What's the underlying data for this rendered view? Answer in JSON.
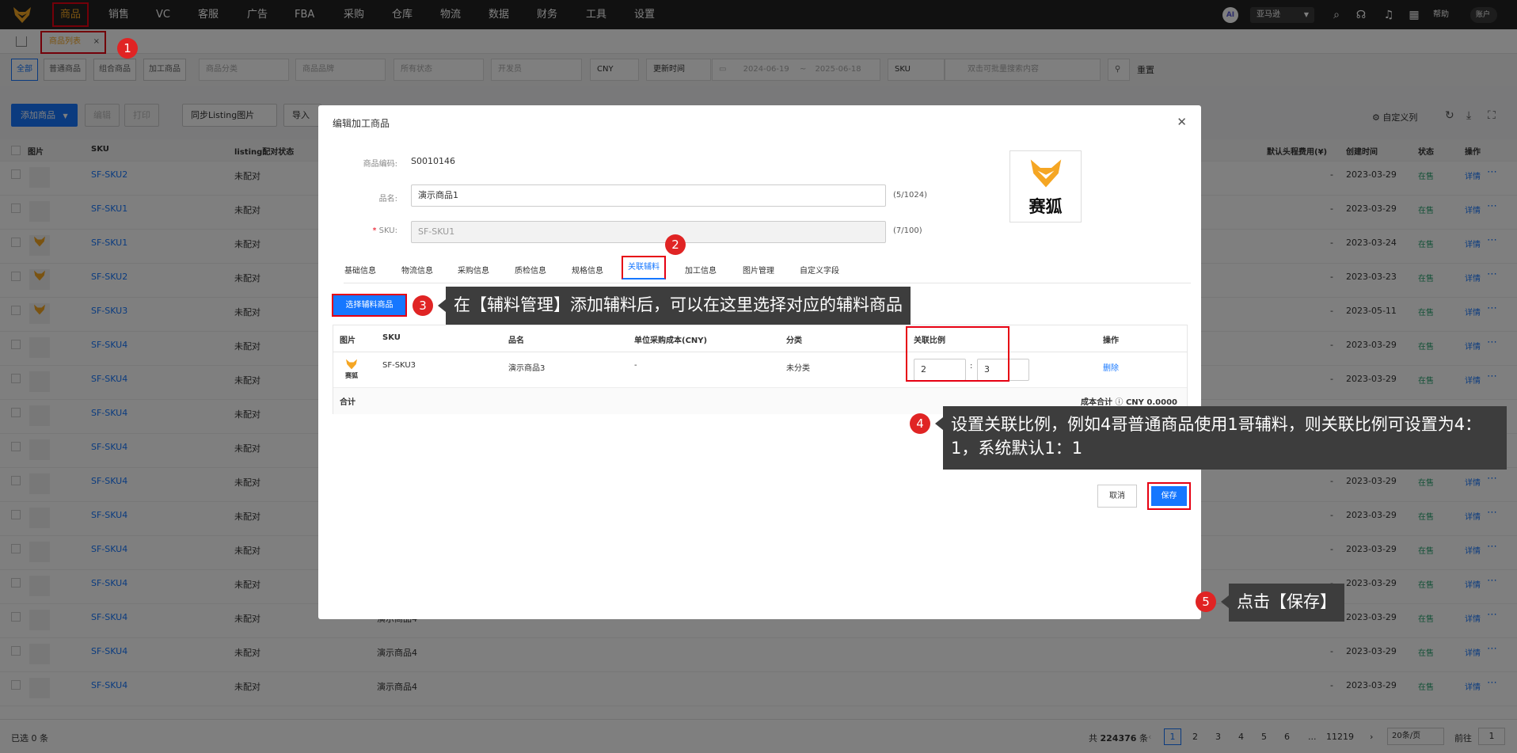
{
  "nav": {
    "items": [
      "商品",
      "销售",
      "VC",
      "客服",
      "广告",
      "FBA",
      "采购",
      "仓库",
      "物流",
      "数据",
      "财务",
      "工具",
      "设置"
    ],
    "ai_label": "AI",
    "store": "亚马逊",
    "help": "帮助",
    "account": "账户"
  },
  "tabs": {
    "current": "商品列表",
    "close": "×"
  },
  "filters": {
    "segments": [
      "全部",
      "普通商品",
      "组合商品",
      "加工商品"
    ],
    "category_ph": "商品分类",
    "brand_ph": "商品品牌",
    "status_ph": "所有状态",
    "developer_ph": "开发员",
    "currency": "CNY",
    "time_type": "更新时间",
    "date_start": "2024-06-19",
    "date_sep": "~",
    "date_end": "2025-06-18",
    "search_field": "SKU",
    "search_ph": "双击可批量搜索内容",
    "reset": "重置"
  },
  "toolbar": {
    "add": "添加商品",
    "edit": "编辑",
    "print": "打印",
    "sync": "同步Listing图片",
    "import": "导入",
    "custom_cols": "自定义列"
  },
  "table": {
    "headers": {
      "image": "图片",
      "sku": "SKU",
      "listing": "listing配对状态",
      "freight": "默认头程费用(¥)",
      "created": "创建时间",
      "status": "状态",
      "ops": "操作"
    },
    "rows": [
      {
        "sku": "SF-SKU2",
        "listing": "未配对",
        "name": "",
        "freight": "-",
        "created": "2023-03-29",
        "status": "在售",
        "detail": "详情",
        "logo": false
      },
      {
        "sku": "SF-SKU1",
        "listing": "未配对",
        "name": "",
        "freight": "-",
        "created": "2023-03-29",
        "status": "在售",
        "detail": "详情",
        "logo": false
      },
      {
        "sku": "SF-SKU1",
        "listing": "未配对",
        "name": "",
        "freight": "-",
        "created": "2023-03-24",
        "status": "在售",
        "detail": "详情",
        "logo": true
      },
      {
        "sku": "SF-SKU2",
        "listing": "未配对",
        "name": "",
        "freight": "-",
        "created": "2023-03-23",
        "status": "在售",
        "detail": "详情",
        "logo": true
      },
      {
        "sku": "SF-SKU3",
        "listing": "未配对",
        "name": "",
        "freight": "-",
        "created": "2023-05-11",
        "status": "在售",
        "detail": "详情",
        "logo": true
      },
      {
        "sku": "SF-SKU4",
        "listing": "未配对",
        "name": "",
        "freight": "-",
        "created": "2023-03-29",
        "status": "在售",
        "detail": "详情",
        "logo": false
      },
      {
        "sku": "SF-SKU4",
        "listing": "未配对",
        "name": "",
        "freight": "-",
        "created": "2023-03-29",
        "status": "在售",
        "detail": "详情",
        "logo": false
      },
      {
        "sku": "SF-SKU4",
        "listing": "未配对",
        "name": "",
        "freight": "-",
        "created": "2023-03-29",
        "status": "在售",
        "detail": "详情",
        "logo": false
      },
      {
        "sku": "SF-SKU4",
        "listing": "未配对",
        "name": "",
        "freight": "-",
        "created": "2023-03-29",
        "status": "在售",
        "detail": "详情",
        "logo": false
      },
      {
        "sku": "SF-SKU4",
        "listing": "未配对",
        "name": "",
        "freight": "-",
        "created": "2023-03-29",
        "status": "在售",
        "detail": "详情",
        "logo": false
      },
      {
        "sku": "SF-SKU4",
        "listing": "未配对",
        "name": "",
        "freight": "-",
        "created": "2023-03-29",
        "status": "在售",
        "detail": "详情",
        "logo": false
      },
      {
        "sku": "SF-SKU4",
        "listing": "未配对",
        "name": "",
        "freight": "-",
        "created": "2023-03-29",
        "status": "在售",
        "detail": "详情",
        "logo": false
      },
      {
        "sku": "SF-SKU4",
        "listing": "未配对",
        "name": "",
        "freight": "-",
        "created": "2023-03-29",
        "status": "在售",
        "detail": "详情",
        "logo": false
      },
      {
        "sku": "SF-SKU4",
        "listing": "未配对",
        "name": "演示商品4",
        "freight": "-",
        "created": "2023-03-29",
        "status": "在售",
        "detail": "详情",
        "logo": false
      },
      {
        "sku": "SF-SKU4",
        "listing": "未配对",
        "name": "演示商品4",
        "freight": "-",
        "created": "2023-03-29",
        "status": "在售",
        "detail": "详情",
        "logo": false
      },
      {
        "sku": "SF-SKU4",
        "listing": "未配对",
        "name": "演示商品4",
        "freight": "-",
        "created": "2023-03-29",
        "status": "在售",
        "detail": "详情",
        "logo": false
      }
    ]
  },
  "footer": {
    "selected": "已选 0 条",
    "total_prefix": "共",
    "total": "224376",
    "total_suffix": "条",
    "pages": [
      "1",
      "2",
      "3",
      "4",
      "5",
      "6"
    ],
    "ellipsis": "...",
    "last_page": "11219",
    "page_size": "20条/页",
    "goto": "前往",
    "goto_value": "1"
  },
  "modal": {
    "title": "编辑加工商品",
    "code_label": "商品编码:",
    "code_value": "S0010146",
    "name_label": "品名:",
    "name_value": "演示商品1",
    "name_count": "(5/1024)",
    "sku_label": "SKU:",
    "sku_value": "SF-SKU1",
    "sku_count": "(7/100)",
    "logo_text": "赛狐",
    "tabs": [
      "基础信息",
      "物流信息",
      "采购信息",
      "质检信息",
      "规格信息",
      "关联辅料",
      "加工信息",
      "图片管理",
      "自定义字段"
    ],
    "select_btn": "选择辅料商品",
    "inner_headers": [
      "图片",
      "SKU",
      "品名",
      "单位采购成本(CNY)",
      "分类",
      "关联比例",
      "操作"
    ],
    "inner_row": {
      "logo_text": "赛狐",
      "sku": "SF-SKU3",
      "name": "演示商品3",
      "cost": "-",
      "category": "未分类",
      "ratio_a": "2",
      "ratio_sep": ":",
      "ratio_b": "3",
      "op": "删除"
    },
    "sum_label": "合计",
    "cost_total_label": "成本合计",
    "cost_total_value": "CNY 0.0000",
    "cancel": "取消",
    "save": "保存"
  },
  "annotations": {
    "badges": [
      "1",
      "2",
      "3",
      "4",
      "5"
    ],
    "callout3": "在【辅料管理】添加辅料后，可以在这里选择对应的辅料商品",
    "callout4": "设置关联比例，例如4哥普通商品使用1哥辅料，则关联比例可设置为4：1，系统默认1：1",
    "callout5": "点击【保存】"
  },
  "colors": {
    "accent": "#1677ff",
    "brand": "#f5a623",
    "highlight": "#e60012",
    "onsale": "#2ba471"
  }
}
